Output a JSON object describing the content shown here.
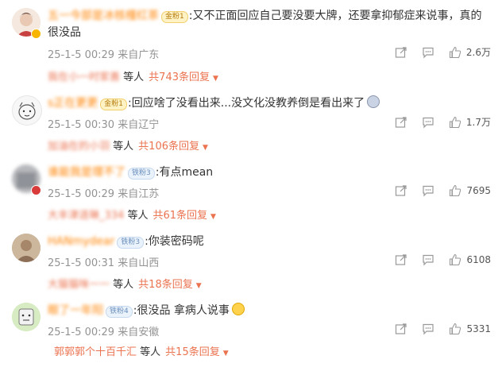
{
  "icons": [
    "share-icon",
    "comment-icon",
    "like-icon"
  ],
  "colors": {
    "accent": "#eb7350",
    "nick": "#ff8200",
    "meta": "#939393"
  },
  "comments": [
    {
      "nick": "五一今部是冰核槿红茶",
      "medal": "金粉1",
      "text": ":又不正面回应自己要没要大牌，还要拿抑郁症来说事，真的很没品",
      "time": "25-1-5 00:29",
      "location": "来自广东",
      "likes": "2.6万",
      "reply_names": "我在小一时家善",
      "reply_suffix": "等人",
      "reply_total": "共743条回复"
    },
    {
      "nick": "s正在更更",
      "medal": "金粉1",
      "text": ":回应啥了没看出来...没文化没教养倒是看出来了",
      "time": "25-1-5 00:30",
      "location": "来自辽宁",
      "likes": "1.7万",
      "reply_names": "加油在的小羽",
      "reply_suffix": "等人",
      "reply_total": "共106条回复"
    },
    {
      "nick": "谁能我是理不了",
      "medal": "铁粉3",
      "text": ":有点mean",
      "time": "25-1-5 00:29",
      "location": "来自江苏",
      "likes": "7695",
      "reply_names": "大丰津涟琳_334",
      "reply_suffix": "等人",
      "reply_total": "共61条回复"
    },
    {
      "nick": "HANmydear",
      "medal": "铁粉3",
      "text": ":你装密码呢",
      "time": "25-1-5 00:31",
      "location": "来自山西",
      "likes": "6108",
      "reply_names": "大猫猫咪一一",
      "reply_suffix": "等人",
      "reply_total": "共18条回复"
    },
    {
      "nick": "眼了一年阳",
      "medal": "铁粉4",
      "text": ":很没品 拿病人说事",
      "time": "25-1-5 00:29",
      "location": "来自安徽",
      "likes": "5331",
      "reply_names": "郭郭郭个十百千汇",
      "reply_suffix": "等人",
      "reply_total": "共15条回复"
    }
  ]
}
